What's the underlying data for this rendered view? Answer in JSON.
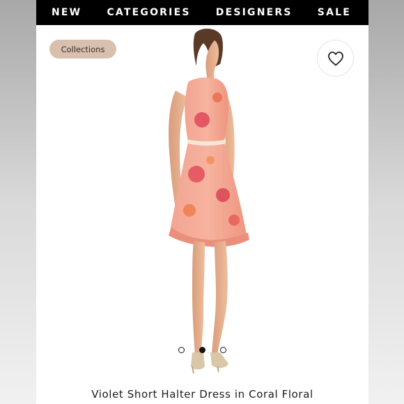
{
  "nav": {
    "items": [
      {
        "label": "NEW"
      },
      {
        "label": "CATEGORIES"
      },
      {
        "label": "DESIGNERS"
      },
      {
        "label": "SALE"
      }
    ]
  },
  "collections_chip": {
    "label": "Collections"
  },
  "favorite": {
    "icon": "heart-icon"
  },
  "carousel": {
    "count": 3,
    "active_index": 1
  },
  "product": {
    "title": "Violet Short Halter Dress in Coral Floral"
  },
  "colors": {
    "nav_bg": "#000000",
    "chip_bg": "#d8bfae",
    "dress": "#f0a090"
  }
}
